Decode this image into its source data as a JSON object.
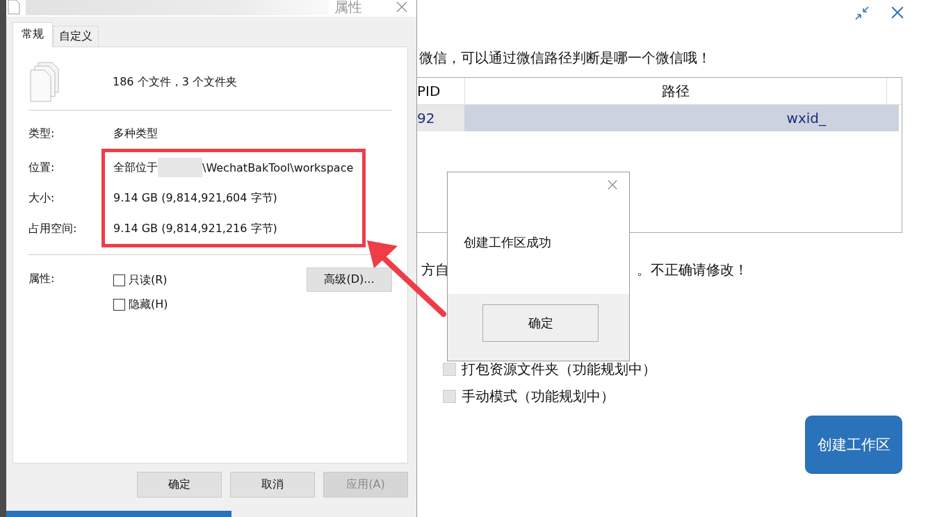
{
  "app": {
    "instruction": "微信，可以通过微信路径判断是哪一个微信哦！",
    "table": {
      "columns": [
        "PID",
        "路径"
      ],
      "rows": [
        {
          "cells": [
            "92",
            "wxid_"
          ],
          "selected": true
        }
      ]
    },
    "hint_start": "方自",
    "hint_end": "。不正确请修改！",
    "options": [
      {
        "label": "打包资源文件夹（功能规划中）",
        "checked": false
      },
      {
        "label": "手动模式（功能规划中）",
        "checked": false
      }
    ],
    "create_button": "创建工作区"
  },
  "properties": {
    "title": "属性",
    "tabs": [
      {
        "label": "常规",
        "selected": true
      },
      {
        "label": "自定义",
        "selected": false
      }
    ],
    "summary": "186 个文件，3 个文件夹",
    "fields": [
      {
        "label": "类型:",
        "value": "多种类型",
        "highlighted": false
      },
      {
        "label": "位置:",
        "prefix": "全部位于",
        "value": "\\WechatBakTool\\workspace",
        "highlighted": true
      },
      {
        "label": "大小:",
        "value": "9.14 GB (9,814,921,604 字节)",
        "highlighted": true
      },
      {
        "label": "占用空间:",
        "value": "9.14 GB (9,814,921,216 字节)",
        "highlighted": true
      }
    ],
    "attributes_label": "属性:",
    "attributes": [
      {
        "label": "只读(R)",
        "checked": false
      },
      {
        "label": "隐藏(H)",
        "checked": false
      }
    ],
    "advanced_button": "高级(D)...",
    "buttons": [
      {
        "label": "确定",
        "disabled": false
      },
      {
        "label": "取消",
        "disabled": false
      },
      {
        "label": "应用(A)",
        "disabled": true
      }
    ]
  },
  "message_box": {
    "text": "创建工作区成功",
    "button": "确定"
  }
}
